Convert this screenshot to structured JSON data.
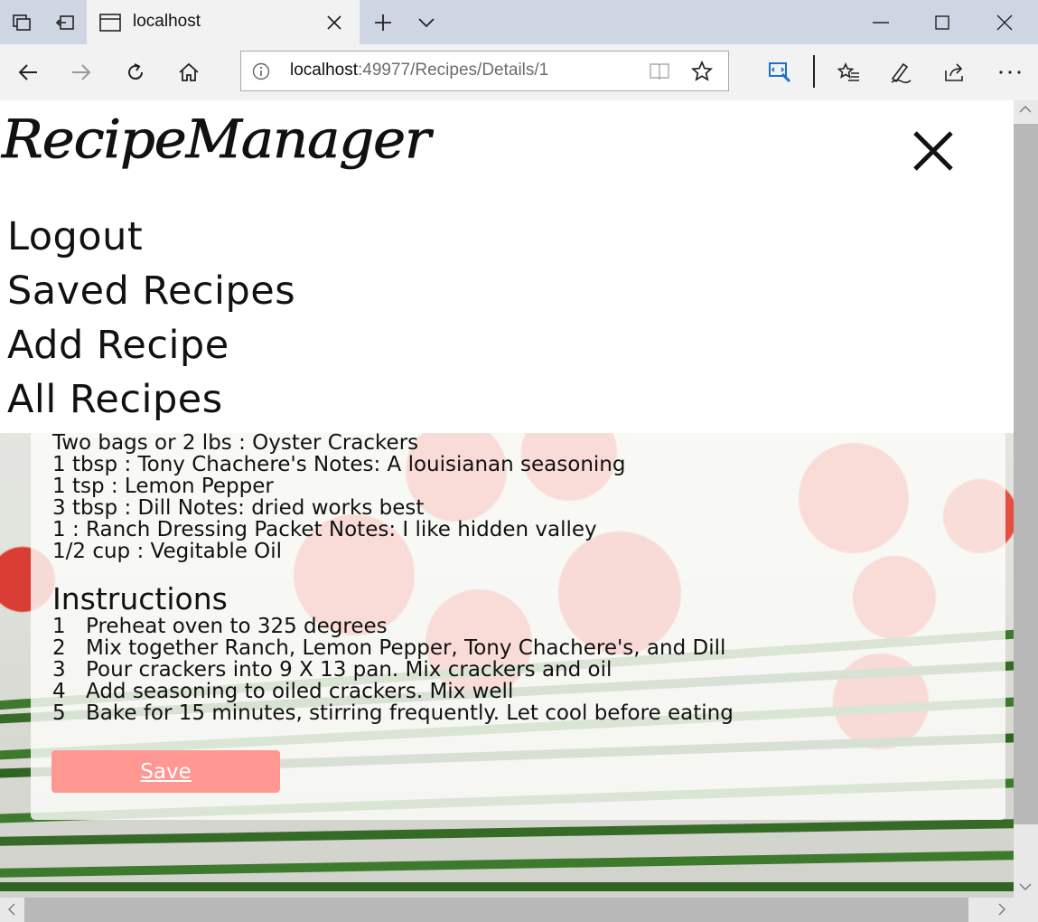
{
  "browser": {
    "tab_title": "localhost",
    "url_host": "localhost",
    "url_path": ":49977/Recipes/Details/1"
  },
  "app": {
    "logo_text": "RecipeManager"
  },
  "menu": {
    "items": [
      {
        "label": "Logout"
      },
      {
        "label": "Saved Recipes"
      },
      {
        "label": "Add Recipe"
      },
      {
        "label": "All Recipes"
      }
    ]
  },
  "recipe": {
    "ingredients": [
      "Two bags or 2 lbs : Oyster Crackers",
      "1 tbsp : Tony Chachere's Notes: A louisianan seasoning",
      "1 tsp : Lemon Pepper",
      "3 tbsp : Dill Notes: dried works best",
      "1 : Ranch Dressing Packet Notes: I like hidden valley",
      "1/2 cup : Vegitable Oil"
    ],
    "instructions_heading": "Instructions",
    "steps": [
      {
        "num": "1",
        "text": "Preheat oven to 325 degrees"
      },
      {
        "num": "2",
        "text": "Mix together Ranch, Lemon Pepper, Tony Chachere's, and Dill"
      },
      {
        "num": "3",
        "text": "Pour crackers into 9 X 13 pan. Mix crackers and oil"
      },
      {
        "num": "4",
        "text": "Add seasoning to oiled crackers. Mix well"
      },
      {
        "num": "5",
        "text": "Bake for 15 minutes, stirring frequently. Let cool before eating"
      }
    ],
    "save_label": "Save"
  },
  "colors": {
    "save_button": "#ff9792",
    "tab_strip": "#cfd6e3"
  }
}
